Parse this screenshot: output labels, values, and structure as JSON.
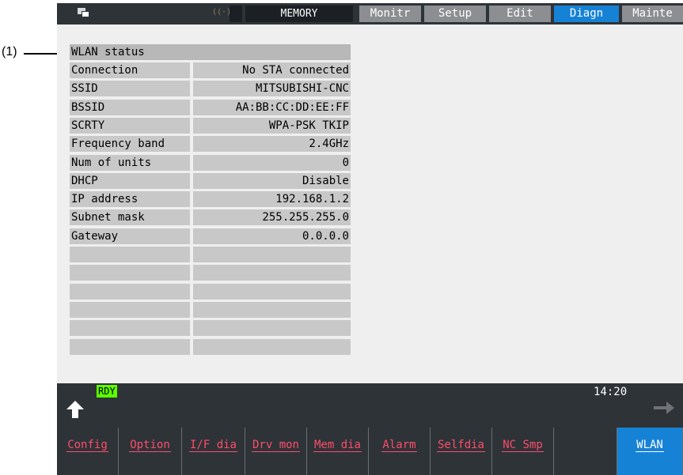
{
  "annotation": {
    "label": "(1)"
  },
  "header": {
    "mode": "MEMORY",
    "tabs": [
      {
        "label": "Monitr",
        "active": false
      },
      {
        "label": "Setup",
        "active": false
      },
      {
        "label": "Edit",
        "active": false
      },
      {
        "label": "Diagn",
        "active": true
      },
      {
        "label": "Mainte",
        "active": false
      }
    ]
  },
  "wlan": {
    "title": "WLAN status",
    "rows": [
      {
        "label": "Connection",
        "value": "No STA connected"
      },
      {
        "label": "SSID",
        "value": "MITSUBISHI-CNC"
      },
      {
        "label": "BSSID",
        "value": "AA:BB:CC:DD:EE:FF"
      },
      {
        "label": "SCRTY",
        "value": "WPA-PSK TKIP"
      },
      {
        "label": "Frequency band",
        "value": "2.4GHz"
      },
      {
        "label": "Num of units",
        "value": "0"
      },
      {
        "label": "DHCP",
        "value": "Disable"
      },
      {
        "label": "IP address",
        "value": "192.168.1.2"
      },
      {
        "label": "Subnet mask",
        "value": "255.255.255.0"
      },
      {
        "label": "Gateway",
        "value": "0.0.0.0"
      },
      {
        "label": "",
        "value": ""
      },
      {
        "label": "",
        "value": ""
      },
      {
        "label": "",
        "value": ""
      },
      {
        "label": "",
        "value": ""
      },
      {
        "label": "",
        "value": ""
      },
      {
        "label": "",
        "value": ""
      }
    ]
  },
  "status": {
    "ready": "RDY",
    "time": "14:20"
  },
  "menu": [
    {
      "label": "Config",
      "active": false
    },
    {
      "label": "Option",
      "active": false
    },
    {
      "label": "I/F dia",
      "active": false
    },
    {
      "label": "Drv mon",
      "active": false
    },
    {
      "label": "Mem dia",
      "active": false
    },
    {
      "label": "Alarm",
      "active": false
    },
    {
      "label": "Selfdia",
      "active": false
    },
    {
      "label": "NC Smp",
      "active": false
    },
    {
      "label": "",
      "active": false
    },
    {
      "label": "WLAN",
      "active": true
    }
  ],
  "colors": {
    "accent": "#1682d6",
    "menu_text": "#ff4d6a",
    "ready": "#5cff00"
  }
}
